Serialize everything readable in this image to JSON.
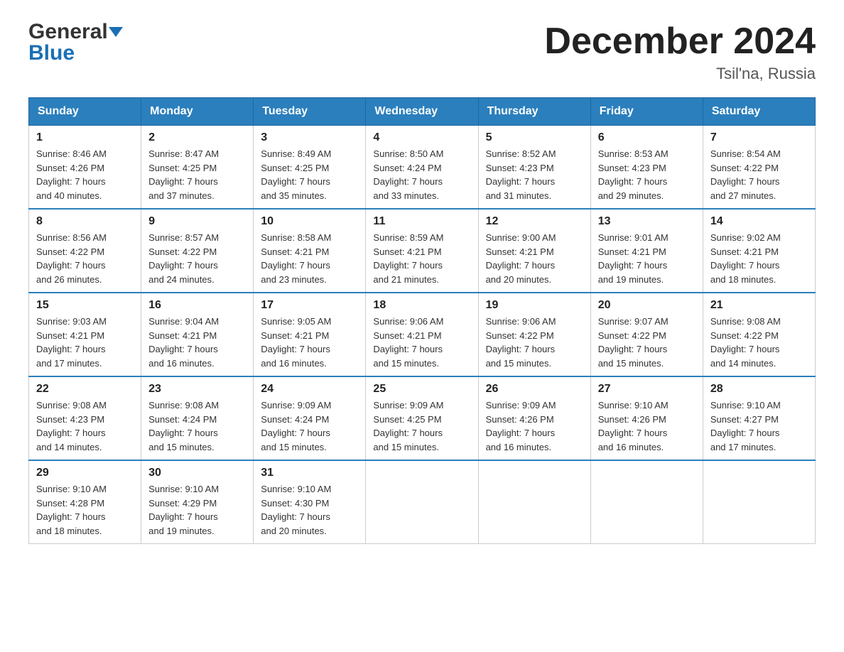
{
  "header": {
    "logo_general": "General",
    "logo_blue": "Blue",
    "title": "December 2024",
    "location": "Tsil'na, Russia"
  },
  "calendar": {
    "days_of_week": [
      "Sunday",
      "Monday",
      "Tuesday",
      "Wednesday",
      "Thursday",
      "Friday",
      "Saturday"
    ],
    "weeks": [
      [
        {
          "day": "1",
          "info": "Sunrise: 8:46 AM\nSunset: 4:26 PM\nDaylight: 7 hours\nand 40 minutes."
        },
        {
          "day": "2",
          "info": "Sunrise: 8:47 AM\nSunset: 4:25 PM\nDaylight: 7 hours\nand 37 minutes."
        },
        {
          "day": "3",
          "info": "Sunrise: 8:49 AM\nSunset: 4:25 PM\nDaylight: 7 hours\nand 35 minutes."
        },
        {
          "day": "4",
          "info": "Sunrise: 8:50 AM\nSunset: 4:24 PM\nDaylight: 7 hours\nand 33 minutes."
        },
        {
          "day": "5",
          "info": "Sunrise: 8:52 AM\nSunset: 4:23 PM\nDaylight: 7 hours\nand 31 minutes."
        },
        {
          "day": "6",
          "info": "Sunrise: 8:53 AM\nSunset: 4:23 PM\nDaylight: 7 hours\nand 29 minutes."
        },
        {
          "day": "7",
          "info": "Sunrise: 8:54 AM\nSunset: 4:22 PM\nDaylight: 7 hours\nand 27 minutes."
        }
      ],
      [
        {
          "day": "8",
          "info": "Sunrise: 8:56 AM\nSunset: 4:22 PM\nDaylight: 7 hours\nand 26 minutes."
        },
        {
          "day": "9",
          "info": "Sunrise: 8:57 AM\nSunset: 4:22 PM\nDaylight: 7 hours\nand 24 minutes."
        },
        {
          "day": "10",
          "info": "Sunrise: 8:58 AM\nSunset: 4:21 PM\nDaylight: 7 hours\nand 23 minutes."
        },
        {
          "day": "11",
          "info": "Sunrise: 8:59 AM\nSunset: 4:21 PM\nDaylight: 7 hours\nand 21 minutes."
        },
        {
          "day": "12",
          "info": "Sunrise: 9:00 AM\nSunset: 4:21 PM\nDaylight: 7 hours\nand 20 minutes."
        },
        {
          "day": "13",
          "info": "Sunrise: 9:01 AM\nSunset: 4:21 PM\nDaylight: 7 hours\nand 19 minutes."
        },
        {
          "day": "14",
          "info": "Sunrise: 9:02 AM\nSunset: 4:21 PM\nDaylight: 7 hours\nand 18 minutes."
        }
      ],
      [
        {
          "day": "15",
          "info": "Sunrise: 9:03 AM\nSunset: 4:21 PM\nDaylight: 7 hours\nand 17 minutes."
        },
        {
          "day": "16",
          "info": "Sunrise: 9:04 AM\nSunset: 4:21 PM\nDaylight: 7 hours\nand 16 minutes."
        },
        {
          "day": "17",
          "info": "Sunrise: 9:05 AM\nSunset: 4:21 PM\nDaylight: 7 hours\nand 16 minutes."
        },
        {
          "day": "18",
          "info": "Sunrise: 9:06 AM\nSunset: 4:21 PM\nDaylight: 7 hours\nand 15 minutes."
        },
        {
          "day": "19",
          "info": "Sunrise: 9:06 AM\nSunset: 4:22 PM\nDaylight: 7 hours\nand 15 minutes."
        },
        {
          "day": "20",
          "info": "Sunrise: 9:07 AM\nSunset: 4:22 PM\nDaylight: 7 hours\nand 15 minutes."
        },
        {
          "day": "21",
          "info": "Sunrise: 9:08 AM\nSunset: 4:22 PM\nDaylight: 7 hours\nand 14 minutes."
        }
      ],
      [
        {
          "day": "22",
          "info": "Sunrise: 9:08 AM\nSunset: 4:23 PM\nDaylight: 7 hours\nand 14 minutes."
        },
        {
          "day": "23",
          "info": "Sunrise: 9:08 AM\nSunset: 4:24 PM\nDaylight: 7 hours\nand 15 minutes."
        },
        {
          "day": "24",
          "info": "Sunrise: 9:09 AM\nSunset: 4:24 PM\nDaylight: 7 hours\nand 15 minutes."
        },
        {
          "day": "25",
          "info": "Sunrise: 9:09 AM\nSunset: 4:25 PM\nDaylight: 7 hours\nand 15 minutes."
        },
        {
          "day": "26",
          "info": "Sunrise: 9:09 AM\nSunset: 4:26 PM\nDaylight: 7 hours\nand 16 minutes."
        },
        {
          "day": "27",
          "info": "Sunrise: 9:10 AM\nSunset: 4:26 PM\nDaylight: 7 hours\nand 16 minutes."
        },
        {
          "day": "28",
          "info": "Sunrise: 9:10 AM\nSunset: 4:27 PM\nDaylight: 7 hours\nand 17 minutes."
        }
      ],
      [
        {
          "day": "29",
          "info": "Sunrise: 9:10 AM\nSunset: 4:28 PM\nDaylight: 7 hours\nand 18 minutes."
        },
        {
          "day": "30",
          "info": "Sunrise: 9:10 AM\nSunset: 4:29 PM\nDaylight: 7 hours\nand 19 minutes."
        },
        {
          "day": "31",
          "info": "Sunrise: 9:10 AM\nSunset: 4:30 PM\nDaylight: 7 hours\nand 20 minutes."
        },
        {
          "day": "",
          "info": ""
        },
        {
          "day": "",
          "info": ""
        },
        {
          "day": "",
          "info": ""
        },
        {
          "day": "",
          "info": ""
        }
      ]
    ]
  }
}
